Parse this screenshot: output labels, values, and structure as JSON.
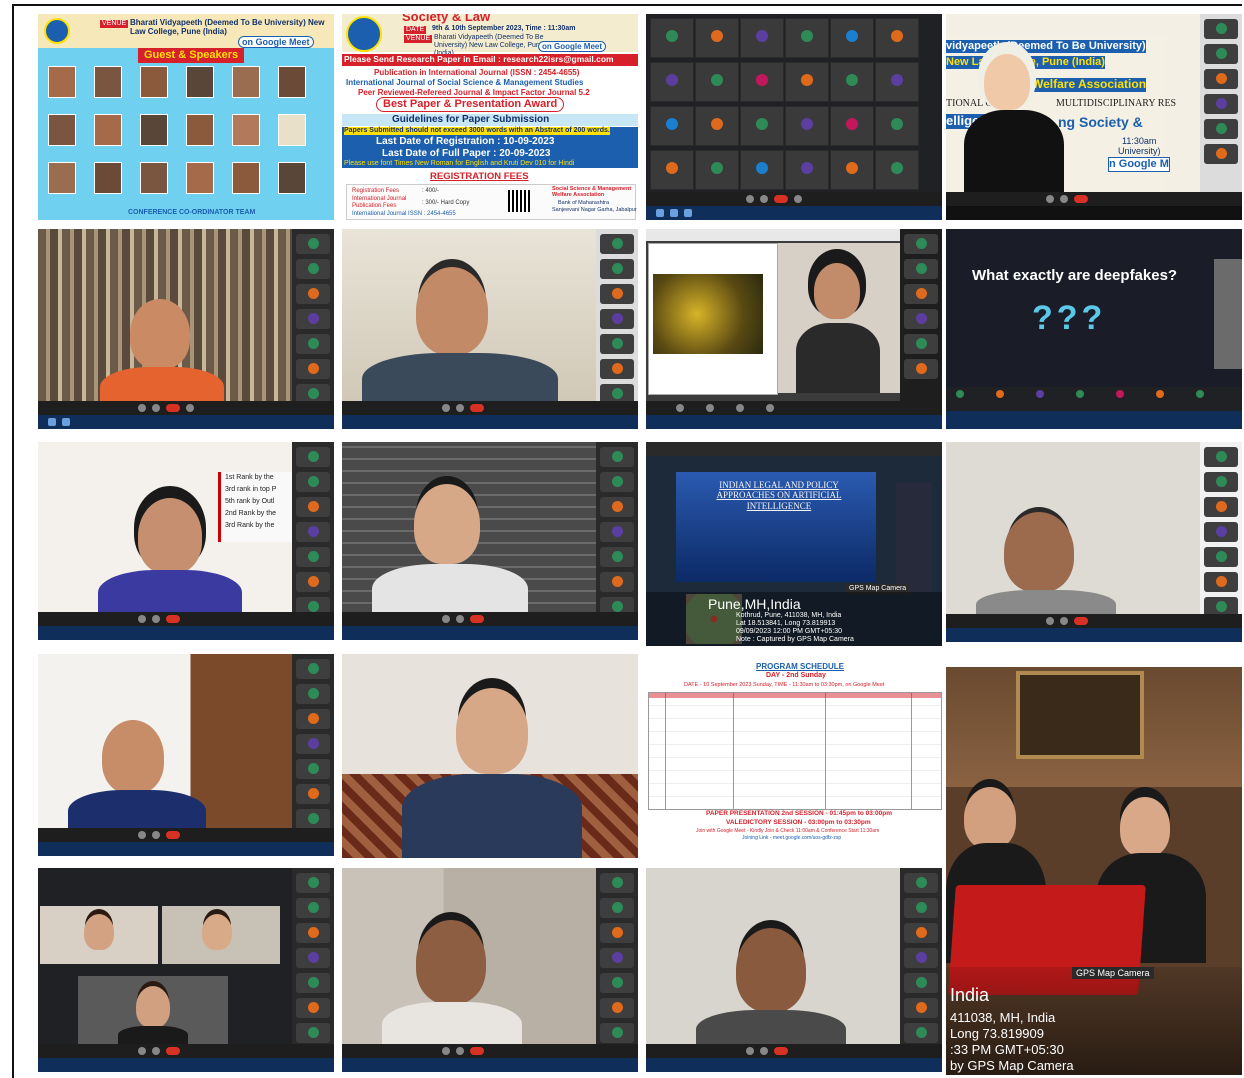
{
  "poster1": {
    "venue_tag": "VENUE",
    "venue": "Bharati Vidyapeeth (Deemed To Be University) New Law College, Pune (India)",
    "meet": "on Google Meet",
    "heading": "Guest & Speakers",
    "team": "CONFERENCE CO-ORDINATOR TEAM"
  },
  "poster2": {
    "title": "Society & Law",
    "date_tag": "DATE",
    "date": "9th & 10th September 2023, Time : 11:30am",
    "venue_tag": "VENUE",
    "venue": "Bharati Vidyapeeth (Deemed To Be University) New Law College, Pune (India)",
    "meet": "on Google Meet",
    "email": "Please Send Research Paper in Email : research22isrs@gmail.com",
    "pub1": "Publication in International Journal (ISSN : 2454-4655)",
    "pub2": "International Journal of Social Science & Management Studies",
    "pub3": "Peer Reviewed-Refereed Journal & Impact Factor Journal 5.2",
    "award": "Best Paper & Presentation Award",
    "guidelines": "Guidelines for Paper Submission",
    "words": "Papers Submitted should not exceed 3000 words with an Abstract of 200 words.",
    "reg_date": "Last Date of Registration : 10-09-2023",
    "paper_date": "Last Date of Full Paper : 20-09-2023",
    "font": "Please use font Times New Roman for English and Kruti Dev 010 for Hindi",
    "fees_heading": "REGISTRATION FEES",
    "fee1_label": "Registration Fees",
    "fee1": ": 400/-",
    "fee2_label": "International Journal Publication Fees",
    "fee2": ": 300/- Hard Copy",
    "issn": "International Journal ISSN : 2454-4655",
    "bank1": "Social Science & Management Welfare Association",
    "bank2": "Bank of Maharashtra",
    "bank3": "Sanjeevani Nagar Garha, Jabalpur"
  },
  "slide4": {
    "l1": "vidyapeeth (Deemed To Be University)",
    "l2": "New Law College, Pune (India)",
    "l3": "Welfare Association",
    "l4": "TIONAL CO",
    "l5": "MULTIDISCIPLINARY RES",
    "l6": "elligen",
    "l7": "ng Society &",
    "l8": "11:30am",
    "l9": "University)",
    "l10": "n Google M"
  },
  "deepfake": {
    "question": "What exactly are deepfakes?",
    "marks": "???"
  },
  "gps1": {
    "slide_title": "INDIAN LEGAL AND POLICY APPROACHES ON ARTIFICIAL INTELLIGENCE",
    "badge": "GPS Map Camera",
    "city": "Pune,MH,India",
    "addr": "Kothrud, Pune, 411038, MH, India",
    "latlong": "Lat 18.513841, Long 73.819913",
    "time": "09/09/2023 12:00 PM GMT+05:30",
    "note": "Note : Captured by GPS Map Camera"
  },
  "schedule": {
    "title": "PROGRAM SCHEDULE",
    "day": "DAY - 2nd Sunday",
    "date_line": "DATE - 10 September 2023 Sunday, TIME - 11:30am to 03:30pm, on Google Meet",
    "session": "PAPER PRESENTATION 2nd SESSION - 01:45pm to 03:00pm",
    "valedictory": "VALEDICTORY SESSION - 03:00pm to 03:30pm",
    "join": "Join with Google Meet - Kindly Join & Check 11:00am & Conference Start 11:30am",
    "link": "Joining Link - meet.google.com/uos-gdfz-zsp"
  },
  "gps2": {
    "badge": "GPS Map Camera",
    "city": "India",
    "addr": "411038, MH, India",
    "latlong": "Long 73.819909",
    "time": ":33 PM GMT+05:30",
    "note": "by GPS Map Camera"
  },
  "slide_r2": {
    "labels": [
      "1st Rank by the",
      "3rd rank in top P",
      "5th rank by Outl",
      "2nd Rank by the",
      "3rd Rank by the"
    ]
  },
  "colors": {
    "poster_blue": "#1b5fae",
    "poster_red": "#d6202a",
    "poster_yellow": "#ffe000",
    "meet_dark": "#3c3c3c",
    "deepfake_bg": "#1a1c28"
  }
}
